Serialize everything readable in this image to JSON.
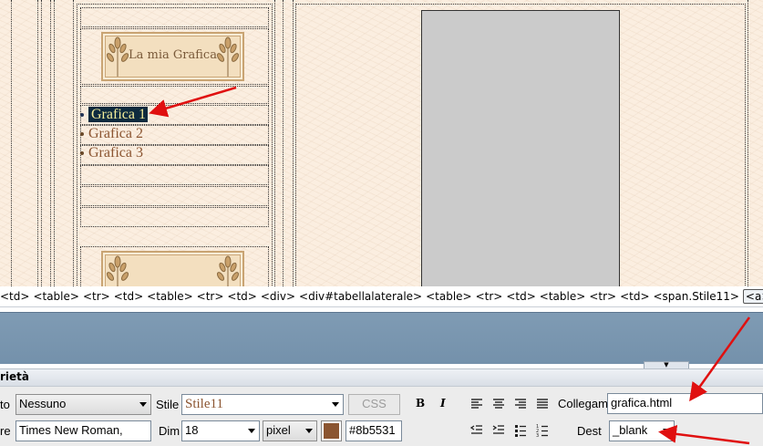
{
  "design": {
    "logo_text": "La mia Grafica",
    "nav_items": [
      {
        "label": "Grafica 1",
        "selected": true
      },
      {
        "label": "Grafica 2",
        "selected": false
      },
      {
        "label": "Grafica 3",
        "selected": false
      }
    ],
    "link_color": "#8b5531",
    "selection_color": "#0d2a3e",
    "page_background": "#fbeee0",
    "content_placeholder_color": "#cbcbcb"
  },
  "tag_selector": {
    "tags": [
      "<td>",
      "<table>",
      "<tr>",
      "<td>",
      "<table>",
      "<tr>",
      "<td>",
      "<div>",
      "<div#tabellalaterale>",
      "<table>",
      "<tr>",
      "<td>",
      "<table>",
      "<tr>",
      "<td>",
      "<span.Stile11>"
    ],
    "current_tag": "<a>"
  },
  "properties": {
    "title": "rietà",
    "format_label": "to",
    "format_value": "Nessuno",
    "style_label": "Stile",
    "style_value": "Stile11",
    "css_button": "CSS",
    "bold_label": "B",
    "italic_label": "I",
    "link_label": "Collegam",
    "link_value": "grafica.html",
    "font_label": "re",
    "font_value": "Times New Roman,",
    "size_label": "Dim",
    "size_value": "18",
    "unit_value": "pixel",
    "color_swatch": "#8b5531",
    "color_value": "#8b5531",
    "target_label": "Dest",
    "target_value": "_blank"
  },
  "colors": {
    "panel_blue": "#7a96b0",
    "annotation_red": "#e01010"
  }
}
